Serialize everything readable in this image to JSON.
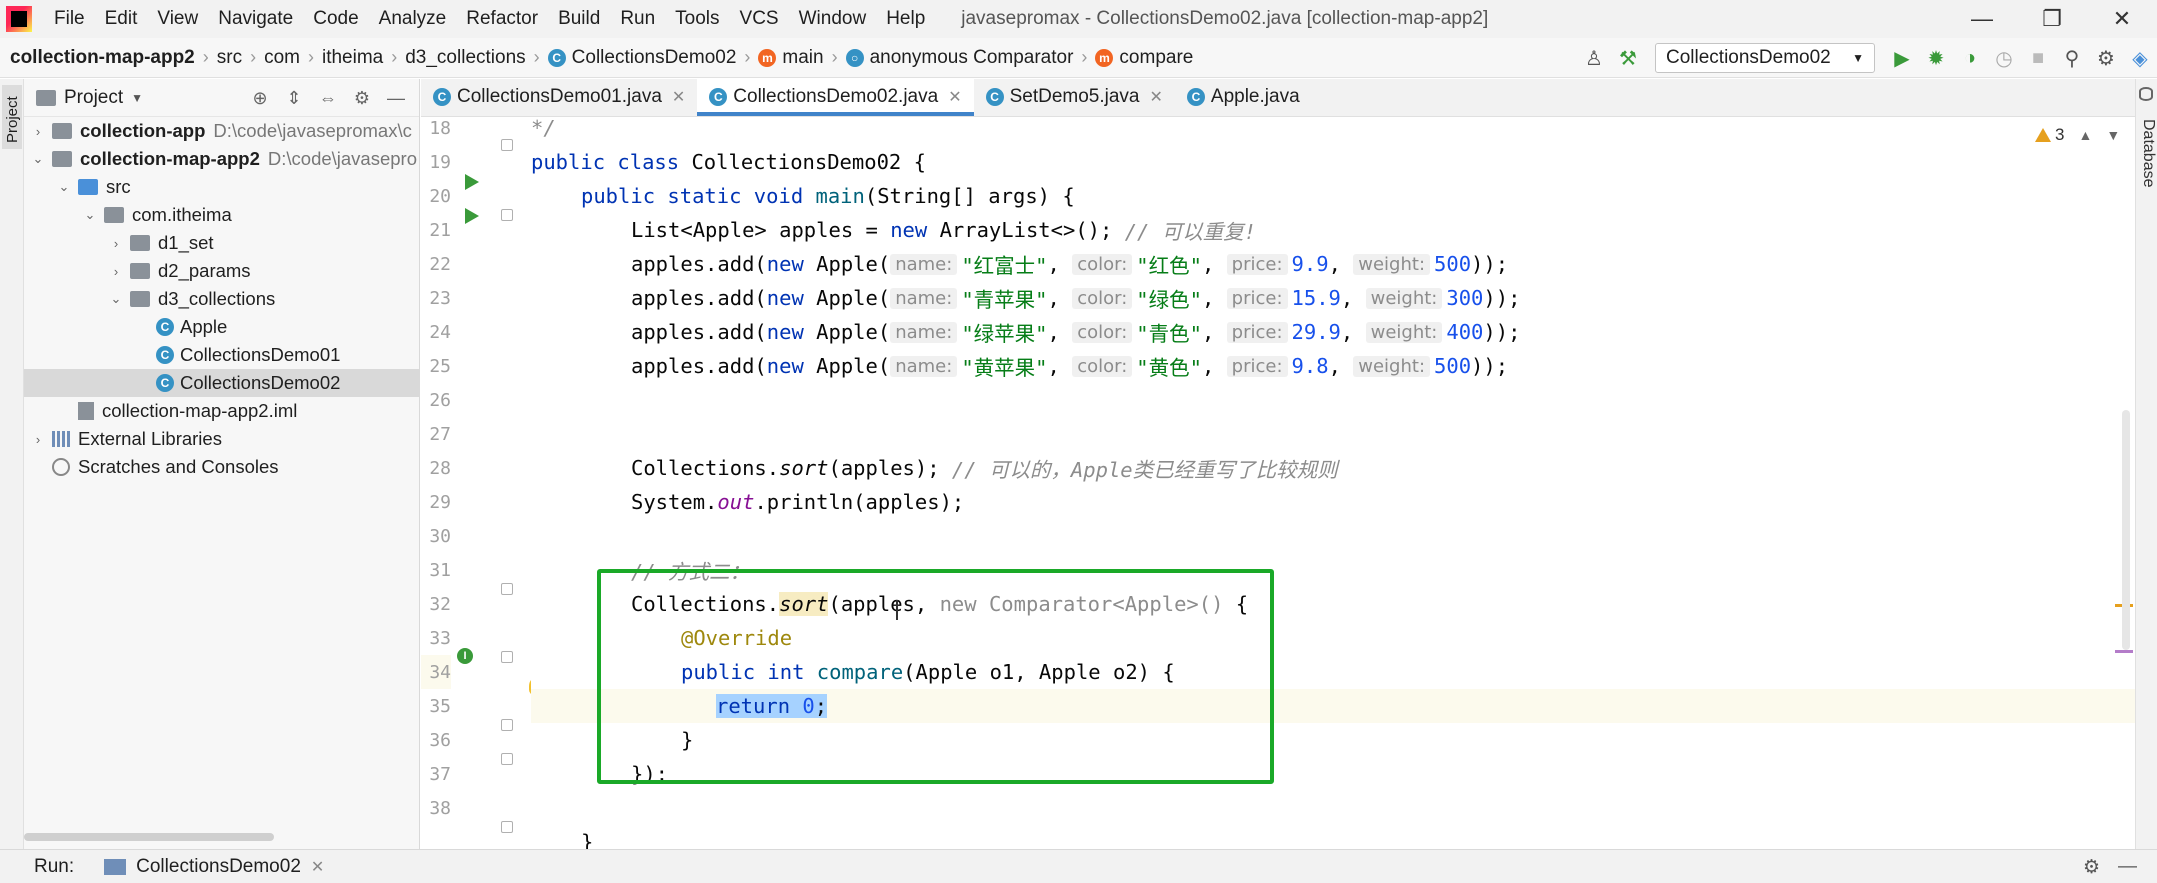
{
  "menubar": {
    "items": [
      "File",
      "Edit",
      "View",
      "Navigate",
      "Code",
      "Analyze",
      "Refactor",
      "Build",
      "Run",
      "Tools",
      "VCS",
      "Window",
      "Help"
    ],
    "window_title": "javasepromax - CollectionsDemo02.java [collection-map-app2]"
  },
  "navbar": {
    "crumbs": [
      "collection-map-app2",
      "src",
      "com",
      "itheima",
      "d3_collections",
      "CollectionsDemo02",
      "main",
      "anonymous Comparator",
      "compare"
    ],
    "run_config": "CollectionsDemo02"
  },
  "stripes": {
    "project": "Project",
    "database": "Database"
  },
  "project": {
    "title": "Project",
    "tree": [
      {
        "label": "collection-app",
        "path": "D:\\code\\javasepromax\\c",
        "indent": 0,
        "arrow": "›",
        "icon": "module",
        "bold": true
      },
      {
        "label": "collection-map-app2",
        "path": "D:\\code\\javasepro",
        "indent": 0,
        "arrow": "⌄",
        "icon": "module",
        "bold": true
      },
      {
        "label": "src",
        "indent": 1,
        "arrow": "⌄",
        "icon": "src"
      },
      {
        "label": "com.itheima",
        "indent": 2,
        "arrow": "⌄",
        "icon": "package"
      },
      {
        "label": "d1_set",
        "indent": 3,
        "arrow": "›",
        "icon": "package"
      },
      {
        "label": "d2_params",
        "indent": 3,
        "arrow": "›",
        "icon": "package"
      },
      {
        "label": "d3_collections",
        "indent": 3,
        "arrow": "⌄",
        "icon": "package"
      },
      {
        "label": "Apple",
        "indent": 4,
        "icon": "class"
      },
      {
        "label": "CollectionsDemo01",
        "indent": 4,
        "icon": "class"
      },
      {
        "label": "CollectionsDemo02",
        "indent": 4,
        "icon": "class",
        "selected": true
      },
      {
        "label": "collection-map-app2.iml",
        "indent": 1,
        "icon": "iml"
      },
      {
        "label": "External Libraries",
        "indent": 0,
        "arrow": "›",
        "icon": "library"
      },
      {
        "label": "Scratches and Consoles",
        "indent": 0,
        "icon": "scratch"
      }
    ]
  },
  "tabs": [
    {
      "label": "CollectionsDemo01.java",
      "active": false
    },
    {
      "label": "CollectionsDemo02.java",
      "active": true
    },
    {
      "label": "SetDemo5.java",
      "active": false
    },
    {
      "label": "Apple.java",
      "active": false
    }
  ],
  "editor": {
    "warnings_count": "3",
    "line_numbers": [
      "18",
      "19",
      "20",
      "21",
      "22",
      "23",
      "24",
      "25",
      "26",
      "27",
      "28",
      "29",
      "30",
      "31",
      "32",
      "33",
      "34",
      "35",
      "36",
      "37",
      "38"
    ],
    "code": {
      "l18": "*/",
      "l19": [
        "public class ",
        "CollectionsDemo02 {"
      ],
      "l20": [
        "public static void ",
        "main",
        "(String[] args) {"
      ],
      "l21": [
        "List<Apple> apples = ",
        "new ",
        "ArrayList<>(); ",
        "// 可以重复!"
      ],
      "apples": [
        {
          "name": "\"红富士\"",
          "color": "\"红色\"",
          "price": "9.9",
          "weight": "500"
        },
        {
          "name": "\"青苹果\"",
          "color": "\"绿色\"",
          "price": "15.9",
          "weight": "300"
        },
        {
          "name": "\"绿苹果\"",
          "color": "\"青色\"",
          "price": "29.9",
          "weight": "400"
        },
        {
          "name": "\"黄苹果\"",
          "color": "\"黄色\"",
          "price": "9.8",
          "weight": "500"
        }
      ],
      "add_prefix": "apples.add(",
      "add_new": "new ",
      "add_ctor": "Apple(",
      "add_close": "));",
      "hint_name": "name:",
      "hint_color": "color:",
      "hint_price": "price:",
      "hint_weight": "weight:",
      "l27": [
        "Collections.",
        "sort",
        "(apples); ",
        "// 可以的，Apple类已经重写了比较规则"
      ],
      "l28": [
        "System.",
        "out",
        ".println(apples);"
      ],
      "l30": "// 方式二：",
      "l31": [
        "Collections.",
        "sort",
        "(apples, ",
        "new Comparator<Apple>() ",
        "{"
      ],
      "l32": "@Override",
      "l33": [
        "public int ",
        "compare",
        "(Apple o1, Apple o2) {"
      ],
      "l34": [
        "return ",
        "0",
        ";"
      ],
      "l35": "}",
      "l36": "});",
      "l38": "}"
    }
  },
  "runbar": {
    "label": "Run:",
    "tab": "CollectionsDemo02"
  },
  "colors": {
    "accent_tab": "#4083c9",
    "highlight_box": "#1aa928",
    "selection": "#a6d2ff"
  }
}
